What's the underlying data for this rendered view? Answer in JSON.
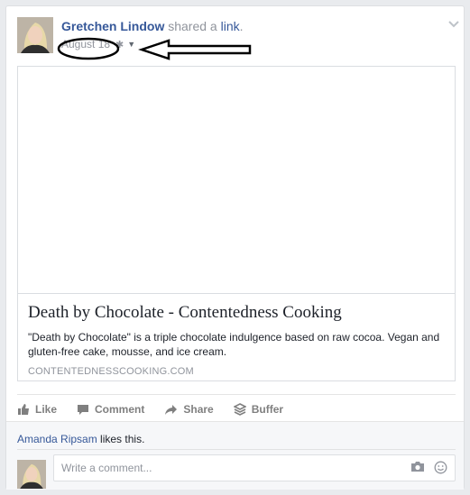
{
  "post": {
    "author": "Gretchen Lindow",
    "action_prefix": "shared a",
    "action_link": "link",
    "action_suffix": ".",
    "date": "August 18",
    "privacy_icon": "gear-icon",
    "audience_icon": "caret-down-icon",
    "menu_icon": "chevron-down-icon"
  },
  "card": {
    "title": "Death by Chocolate - Contentedness Cooking",
    "description": "\"Death by Chocolate\" is a triple chocolate indulgence based on raw cocoa. Vegan and gluten-free cake, mousse, and ice cream.",
    "domain": "CONTENTEDNESSCOOKING.COM"
  },
  "actions": [
    {
      "label": "Like",
      "icon": "thumbs-up-icon"
    },
    {
      "label": "Comment",
      "icon": "comment-icon"
    },
    {
      "label": "Share",
      "icon": "share-arrow-icon"
    },
    {
      "label": "Buffer",
      "icon": "buffer-stack-icon"
    }
  ],
  "likes": {
    "liker": "Amanda Ripsam",
    "suffix": " likes this."
  },
  "comment": {
    "placeholder": "Write a comment..."
  },
  "colors": {
    "link": "#365899",
    "muted": "#90949c",
    "annotation": "#000000"
  }
}
